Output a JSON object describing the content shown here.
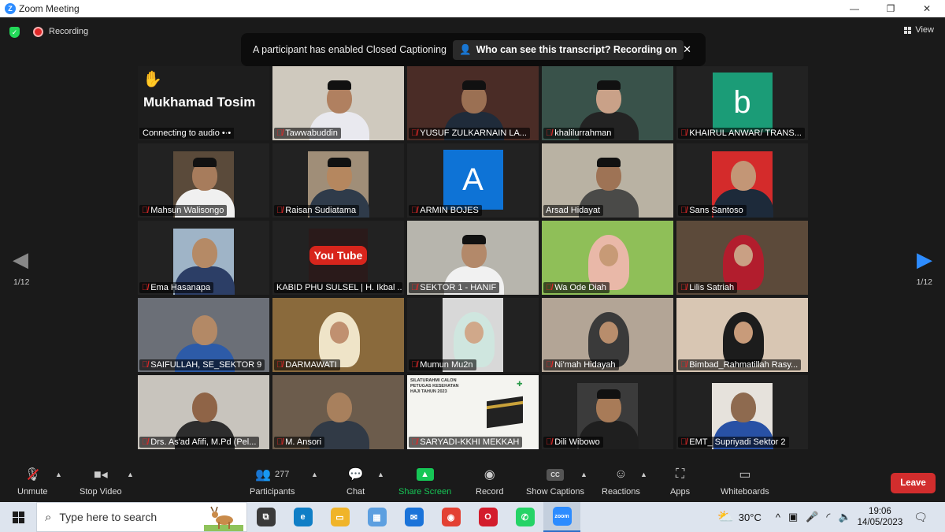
{
  "window": {
    "title": "Zoom Meeting",
    "controls": [
      "—",
      "❐",
      "✕"
    ]
  },
  "status": {
    "recording": "Recording",
    "view": "View"
  },
  "banner": {
    "message": "A participant has enabled Closed Captioning",
    "pill": "Who can see this transcript? Recording on"
  },
  "pages": {
    "left": "1/12",
    "right": "1/12"
  },
  "participants": [
    {
      "name": "Mukhamad Tosim",
      "kind": "text",
      "status": "Connecting to audio"
    },
    {
      "name": "Tawwabuddin",
      "kind": "video",
      "muted": true,
      "bg": "#cfc9be",
      "skin": "#b08060",
      "shirt": "#e9e9ef",
      "cap": true
    },
    {
      "name": "YUSUF ZULKARNAIN LA...",
      "kind": "video",
      "muted": true,
      "bg": "#4a2c26",
      "skin": "#9b7053",
      "shirt": "#1f2b3a",
      "cap": true
    },
    {
      "name": "khalilurrahman",
      "kind": "video",
      "muted": true,
      "bg": "#39524a",
      "skin": "#c9a188",
      "shirt": "#232323",
      "cap": true
    },
    {
      "name": "KHAIRUL ANWAR/ TRANS...",
      "kind": "avatar",
      "muted": true,
      "letter": "b",
      "color": "#1b9c77"
    },
    {
      "name": "Mahsun Walisongo",
      "kind": "video",
      "muted": true,
      "bg": "#5a4a3a",
      "skin": "#a77c5c",
      "shirt": "#f0f0f0",
      "cap": true,
      "small": true
    },
    {
      "name": "Raisan Sudiatama",
      "kind": "video",
      "muted": true,
      "bg": "#a08e78",
      "skin": "#b5875f",
      "shirt": "#2f3b4a",
      "cap": true,
      "small": true
    },
    {
      "name": "ARMIN BOJES",
      "kind": "avatar",
      "muted": true,
      "letter": "A",
      "color": "#0e73d6"
    },
    {
      "name": "Arsad Hidayat",
      "kind": "video",
      "muted": false,
      "bg": "#b9b2a3",
      "skin": "#9e7355",
      "shirt": "#4a4a48",
      "cap": true,
      "active": true
    },
    {
      "name": "Sans Santoso",
      "kind": "video",
      "muted": true,
      "bg": "#d42b2b",
      "skin": "#c39676",
      "shirt": "#1d2a3a",
      "small": true
    },
    {
      "name": "Ema Hasanapa",
      "kind": "video",
      "muted": true,
      "bg": "#9fb4c7",
      "skin": "#b58a66",
      "shirt": "#2c3e66",
      "small": true
    },
    {
      "name": "KABID PHU SULSEL | H. Ikbal ...",
      "kind": "logo",
      "muted": false,
      "logo": "You Tube"
    },
    {
      "name": "SEKTOR 1 - HANIF",
      "kind": "video",
      "muted": true,
      "bg": "#b7b5ad",
      "skin": "#b3896a",
      "shirt": "#f1f1f1",
      "cap": true
    },
    {
      "name": "Wa Ode Diah",
      "kind": "hijab",
      "muted": true,
      "bg": "#8fbf58",
      "veil": "#e9b8a8",
      "skin": "#c79a76"
    },
    {
      "name": "Lilis Satriah",
      "kind": "hijab",
      "muted": true,
      "bg": "#5c4a3a",
      "veil": "#b21d2d",
      "skin": "#c9a084"
    },
    {
      "name": "SAIFULLAH, SE_SEKTOR 9",
      "kind": "video",
      "muted": true,
      "bg": "#6b6f77",
      "skin": "#b38966",
      "shirt": "#2d5ba8"
    },
    {
      "name": "DARMAWATI",
      "kind": "hijab",
      "muted": true,
      "bg": "#8a6a3c",
      "veil": "#efe4c8",
      "skin": "#c09070"
    },
    {
      "name": "Mumun Mu2n",
      "kind": "hijab",
      "muted": true,
      "bg": "#d8d8d8",
      "veil": "#cfe6df",
      "skin": "#d0a88a",
      "small": true
    },
    {
      "name": "Ni'mah Hidayah",
      "kind": "hijab",
      "muted": true,
      "bg": "#b3a596",
      "veil": "#3a3a3a",
      "skin": "#b88d6c"
    },
    {
      "name": "Bimbad_Rahmatillah Rasy...",
      "kind": "hijab",
      "muted": true,
      "bg": "#d8c6b3",
      "veil": "#1c1c1c",
      "skin": "#c89b7a"
    },
    {
      "name": "Drs. As'ad Afifi, M.Pd (Pel...",
      "kind": "video",
      "muted": true,
      "bg": "#c8c4bd",
      "skin": "#8f6447",
      "shirt": "#2d2d2d"
    },
    {
      "name": "M. Ansori",
      "kind": "video",
      "muted": true,
      "bg": "#6c5c4c",
      "skin": "#a8805d",
      "shirt": "#313a46"
    },
    {
      "name": "SARYADI-KKHI MEKKAH",
      "kind": "slide",
      "muted": true,
      "slideText": "SILATURAHMI CALON PETUGAS KESEHATAN HAJI TAHUN 2023"
    },
    {
      "name": "Dili Wibowo",
      "kind": "video",
      "muted": true,
      "bg": "#3b3b3b",
      "skin": "#a87b58",
      "shirt": "#1f1f1f",
      "cap": true,
      "small": true
    },
    {
      "name": "EMT_ Supriyadi Sektor 2",
      "kind": "video",
      "muted": true,
      "bg": "#e6e2dc",
      "skin": "#8e6a4f",
      "shirt": "#2851a5",
      "small": true
    }
  ],
  "toolbar": {
    "unmute": "Unmute",
    "stop_video": "Stop Video",
    "participants": "Participants",
    "participants_count": "277",
    "chat": "Chat",
    "share_screen": "Share Screen",
    "record": "Record",
    "show_captions": "Show Captions",
    "reactions": "Reactions",
    "apps": "Apps",
    "whiteboards": "Whiteboards",
    "leave": "Leave"
  },
  "taskbar": {
    "search_placeholder": "Type here to search",
    "temperature": "30°C",
    "time": "19:06",
    "date": "14/05/2023",
    "apps": [
      {
        "name": "task-view",
        "color": "#3a3a3a",
        "glyph": "⧉"
      },
      {
        "name": "edge",
        "color": "#0f7ec6",
        "glyph": "e"
      },
      {
        "name": "file-explorer",
        "color": "#f0b429",
        "glyph": "▭"
      },
      {
        "name": "store",
        "color": "#5c9fe0",
        "glyph": "▦"
      },
      {
        "name": "mail",
        "color": "#1a73d9",
        "glyph": "✉"
      },
      {
        "name": "chrome",
        "color": "#e34133",
        "glyph": "◉"
      },
      {
        "name": "opera",
        "color": "#d31c2c",
        "glyph": "O"
      },
      {
        "name": "whatsapp",
        "color": "#25d366",
        "glyph": "✆"
      },
      {
        "name": "zoom",
        "color": "#2d8cff",
        "glyph": "zoom",
        "active": true
      }
    ]
  }
}
